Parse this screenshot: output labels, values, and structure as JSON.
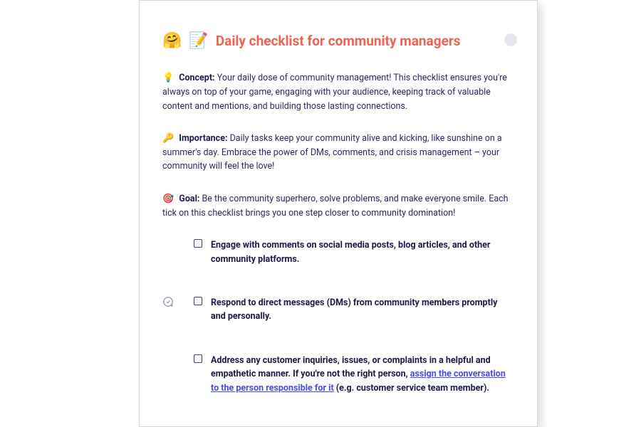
{
  "header": {
    "emoji1": "🤗",
    "emoji2": "📝",
    "title": "Daily checklist for community managers"
  },
  "sections": {
    "concept": {
      "emoji": "💡",
      "label": "Concept:",
      "body": "Your daily dose of community management! This checklist ensures you're always on top of your game, engaging with your audience, keeping track of valuable content and mentions, and building those lasting connections."
    },
    "importance": {
      "emoji": "🔑",
      "label": "Importance:",
      "body": "Daily tasks keep your community alive and kicking, like sunshine on a summer's day. Embrace the power of DMs, comments, and crisis management – your community will feel the love!"
    },
    "goal": {
      "emoji": "🎯",
      "label": "Goal:",
      "body": "Be the community superhero, solve problems, and make everyone smile. Each tick on this checklist brings you one step closer to community domination!"
    }
  },
  "checklist": [
    {
      "text": "Engage with comments on social media posts, blog articles, and other community platforms.",
      "link": null,
      "tail": null,
      "show_gutter_icon": false
    },
    {
      "text": "Respond to direct messages (DMs) from community members promptly and personally.",
      "link": null,
      "tail": null,
      "show_gutter_icon": true
    },
    {
      "text": "Address any customer inquiries, issues, or complaints in a helpful and empathetic manner. If you're not the right person, ",
      "link": "assign the conversation to the person responsible for it",
      "tail": " (e.g. customer service team member).",
      "show_gutter_icon": false
    }
  ]
}
